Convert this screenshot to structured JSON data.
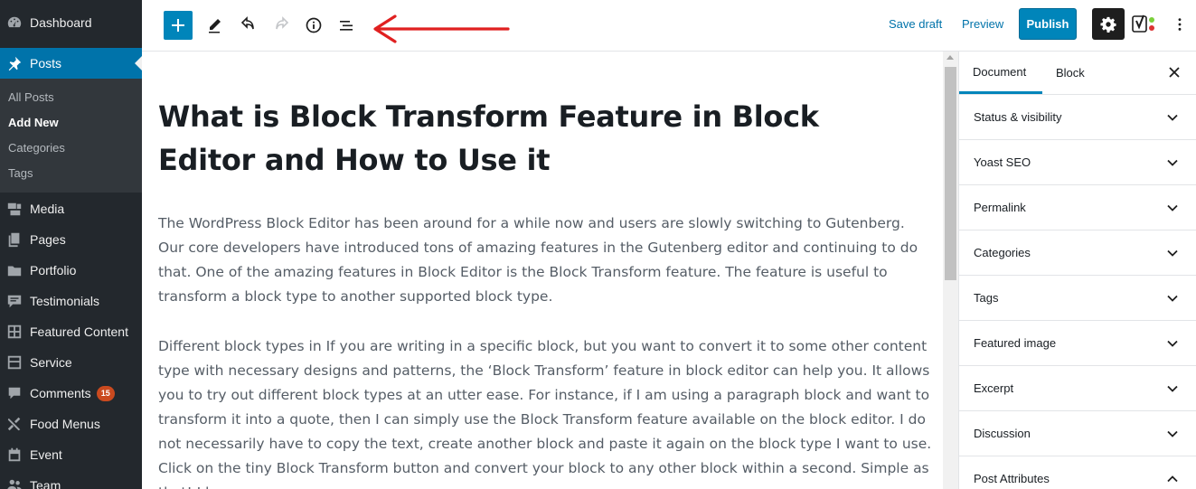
{
  "sidebar": {
    "menu": [
      {
        "label": "Dashboard",
        "icon": "dashboard-icon"
      },
      {
        "label": "Posts",
        "icon": "pin-icon"
      },
      {
        "label": "Media",
        "icon": "media-icon"
      },
      {
        "label": "Pages",
        "icon": "pages-icon"
      },
      {
        "label": "Portfolio",
        "icon": "folder-icon"
      },
      {
        "label": "Testimonials",
        "icon": "testimonial-icon"
      },
      {
        "label": "Featured Content",
        "icon": "grid-icon"
      },
      {
        "label": "Service",
        "icon": "service-icon"
      },
      {
        "label": "Comments",
        "icon": "comment-icon",
        "badge": "15"
      },
      {
        "label": "Food Menus",
        "icon": "food-icon"
      },
      {
        "label": "Event",
        "icon": "calendar-icon"
      },
      {
        "label": "Team",
        "icon": "team-icon"
      }
    ],
    "submenu": [
      "All Posts",
      "Add New",
      "Categories",
      "Tags"
    ]
  },
  "toolbar": {
    "save_draft": "Save draft",
    "preview": "Preview",
    "publish": "Publish"
  },
  "editor": {
    "title": "What is Block Transform Feature in Block Editor and How to Use it",
    "paragraphs": [
      "The WordPress Block Editor has been around for a while now and users are slowly switching to Gutenberg. Our core developers have introduced tons of amazing features in the Gutenberg editor and continuing to do that. One of the amazing features in Block Editor is the Block Transform feature. The feature is useful to transform a block type to another supported block type.",
      "Different block types in If you are writing in a specific block, but you want to convert it to some other content type with necessary designs and patterns, the ‘Block Transform’ feature in block editor can help you. It allows you to try out different block types at an utter ease. For instance, if I am using a paragraph block and want to transform it into a quote, then I can simply use the Block Transform feature available on the block editor. I do not necessarily have to copy the text, create another block and paste it again on the block type I want to use. Click on the tiny Block Transform button and convert your block to any other block within a second. Simple as that! I hope"
    ]
  },
  "panel": {
    "tabs": [
      "Document",
      "Block"
    ],
    "sections": [
      "Status & visibility",
      "Yoast SEO",
      "Permalink",
      "Categories",
      "Tags",
      "Featured image",
      "Excerpt",
      "Discussion",
      "Post Attributes"
    ]
  },
  "colors": {
    "admin_bar": "#23282d",
    "accent": "#0085ba",
    "annotation_arrow": "#e02020"
  }
}
